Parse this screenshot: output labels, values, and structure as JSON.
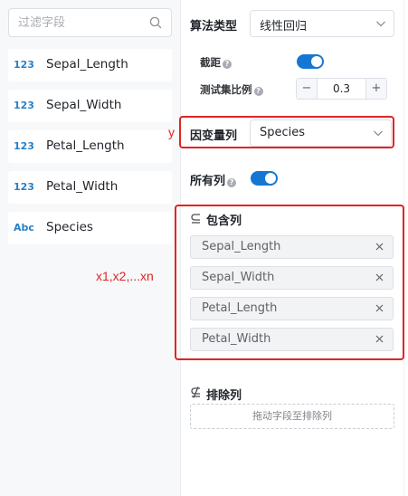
{
  "search": {
    "placeholder": "过滤字段"
  },
  "fields": [
    {
      "type": "123",
      "name": "Sepal_Length"
    },
    {
      "type": "123",
      "name": "Sepal_Width"
    },
    {
      "type": "123",
      "name": "Petal_Length"
    },
    {
      "type": "123",
      "name": "Petal_Width"
    },
    {
      "type": "Abc",
      "name": "Species"
    }
  ],
  "config": {
    "algorithm_label": "算法类型",
    "algorithm_value": "线性回归",
    "intercept_label": "截距",
    "test_ratio_label": "测试集比例",
    "test_ratio_value": "0.3",
    "minus": "−",
    "plus": "+",
    "target_label": "因变量列",
    "target_value": "Species",
    "all_columns_label": "所有列",
    "include_label": "包含列",
    "include_items": [
      "Sepal_Length",
      "Sepal_Width",
      "Petal_Length",
      "Petal_Width"
    ],
    "exclude_label": "排除列",
    "exclude_drop_text": "拖动字段至排除列"
  },
  "toggles": {
    "intercept_on": true,
    "all_columns_on": true
  },
  "annotations": {
    "y_label": "y",
    "x_label": "x1,x2,...xn",
    "color": "#e02424"
  },
  "colors": {
    "accent": "#1677d2",
    "type_badge": "#2a80c4"
  }
}
